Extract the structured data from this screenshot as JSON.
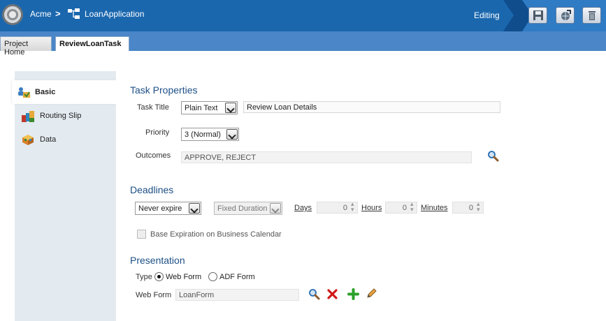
{
  "header": {
    "root": "Acme",
    "separator": ">",
    "app": "LoanApplication",
    "mode": "Editing"
  },
  "tabs": [
    {
      "label": "Project Home",
      "active": false
    },
    {
      "label": "ReviewLoanTask",
      "active": true
    }
  ],
  "sidebar": {
    "items": [
      {
        "label": "Basic",
        "icon": "basic-icon",
        "active": true
      },
      {
        "label": "Routing Slip",
        "icon": "routing-slip-icon",
        "active": false
      },
      {
        "label": "Data",
        "icon": "data-icon",
        "active": false
      }
    ]
  },
  "task_properties": {
    "title": "Task Properties",
    "task_title_label": "Task Title",
    "task_title_type": "Plain Text",
    "task_title_value": "Review Loan  Details",
    "priority_label": "Priority",
    "priority_value": "3 (Normal)",
    "outcomes_label": "Outcomes",
    "outcomes_value": "APPROVE, REJECT"
  },
  "deadlines": {
    "title": "Deadlines",
    "expire_value": "Never expire",
    "duration_value": "Fixed Duration",
    "days_label": "Days",
    "days_value": "0",
    "hours_label": "Hours",
    "hours_value": "0",
    "minutes_label": "Minutes",
    "minutes_value": "0",
    "calendar_label": "Base Expiration on Business Calendar"
  },
  "presentation": {
    "title": "Presentation",
    "type_label": "Type",
    "web_form_option": "Web Form",
    "adf_form_option": "ADF Form",
    "selected_type": "Web Form",
    "web_form_label": "Web Form",
    "web_form_value": "LoanForm"
  },
  "colors": {
    "header_bg": "#1a67ae",
    "tabbar_bg": "#4a86c8",
    "section_title": "#1d4f86",
    "sidebar_bg": "#e3eaf0"
  }
}
